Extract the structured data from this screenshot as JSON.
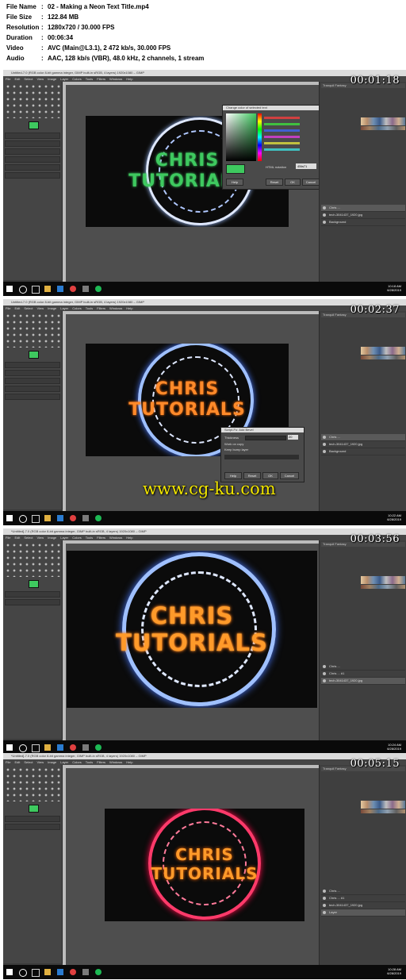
{
  "file_info": {
    "rows": [
      {
        "key": "File Name",
        "value": "02 - Making a Neon Text Title.mp4"
      },
      {
        "key": "File Size",
        "value": "122.84 MB"
      },
      {
        "key": "Resolution",
        "value": "1280x720 / 30.000 FPS"
      },
      {
        "key": "Duration",
        "value": "00:06:34"
      },
      {
        "key": "Video",
        "value": "AVC (Main@L3.1), 2 472 kb/s, 30.000 FPS"
      },
      {
        "key": "Audio",
        "value": "AAC, 128 kb/s (VBR), 48.0 kHz, 2 channels, 1 stream"
      }
    ],
    "separator": ":"
  },
  "frames": [
    {
      "timestamp": "00:01:18",
      "window_title": "Untitled-7.0 (RGB color 8-bit gamma integer, GIMP built-in sRGB, 4 layers) 1920x1080 – GIMP",
      "menu": [
        "File",
        "Edit",
        "Select",
        "View",
        "Image",
        "Layer",
        "Colors",
        "Tools",
        "Filters",
        "Windows",
        "Help"
      ],
      "art_text": [
        "CHRIS",
        "TUTORIALS"
      ],
      "text_color": "#3ec95f",
      "ring_color": "#dfe8ff",
      "panel_title": "Tranquil Fantasy",
      "layers": [
        "Chris ...",
        "tech-3041437_1920.jpg",
        "Background"
      ],
      "dialog": {
        "title": "Change color of selected text",
        "hex_label": "HTML notation",
        "hex_value": "45fa71",
        "buttons": [
          "Help",
          "Reset",
          "OK",
          "Cancel"
        ]
      },
      "clock": {
        "time": "10:18 AM",
        "date": "6/28/2019"
      }
    },
    {
      "timestamp": "00:02:37",
      "window_title": "Untitled-7.0 (RGB color 8-bit gamma integer, GIMP built-in sRGB, 4 layers) 1920x1080 – GIMP",
      "menu": [
        "File",
        "Edit",
        "Select",
        "View",
        "Image",
        "Layer",
        "Colors",
        "Tools",
        "Filters",
        "Windows",
        "Help"
      ],
      "art_text": [
        "CHRIS",
        "TUTORIALS"
      ],
      "text_color": "#ff8a2a",
      "ring_color": "#9fc0ff",
      "panel_title": "Tranquil Fantasy",
      "layers": [
        "Chris ...",
        "tech-3041437_1920.jpg",
        "Background"
      ],
      "dialog": {
        "title": "Script-Fu: Add Bevel",
        "field_label": "Thickness",
        "field_value": "20",
        "option1": "Work on copy",
        "option2": "Keep bump layer",
        "buttons": [
          "Help",
          "Reset",
          "OK",
          "Cancel"
        ]
      },
      "clock": {
        "time": "10:22 AM",
        "date": "6/28/2019"
      }
    },
    {
      "timestamp": "00:03:56",
      "window_title": "*Untitled]-7.0 (RGB color 8-bit gamma integer, GIMP built-in sRGB, 4 layers) 1920x1080 – GIMP",
      "menu": [
        "File",
        "Edit",
        "Select",
        "View",
        "Image",
        "Layer",
        "Colors",
        "Tools",
        "Filters",
        "Windows",
        "Help"
      ],
      "art_text": [
        "CHRIS",
        "TUTORIALS"
      ],
      "text_color": "#ff9a2a",
      "ring_color": "#9fc0ff",
      "panel_title": "Tranquil Fantasy",
      "layers": [
        "Chris ...",
        "Chris ... #1",
        "tech-3041437_1920.jpg"
      ],
      "clock": {
        "time": "10:24 AM",
        "date": "6/28/2019"
      }
    },
    {
      "timestamp": "00:05:15",
      "window_title": "*Untitled]-7.0 (RGB color 8-bit gamma integer, GIMP built-in sRGB, 4 layers) 1920x1080 – GIMP",
      "menu": [
        "File",
        "Edit",
        "Select",
        "View",
        "Image",
        "Layer",
        "Colors",
        "Tools",
        "Filters",
        "Windows",
        "Help"
      ],
      "art_text": [
        "CHRIS",
        "TUTORIALS"
      ],
      "text_color": "#ff9a2a",
      "ring_color": "#ff3a6a",
      "panel_title": "Tranquil Fantasy",
      "layers": [
        "Chris ...",
        "Chris ... #1",
        "tech-3041437_1920.jpg",
        "Layer"
      ],
      "clock": {
        "time": "10:28 AM",
        "date": "6/28/2019"
      }
    }
  ],
  "watermark": "www.cg-ku.com",
  "colors": {
    "background": "#ffffff",
    "gimp_dark": "#3b3b3b",
    "taskbar": "#0a0a0a",
    "watermark": "#f2e600"
  }
}
